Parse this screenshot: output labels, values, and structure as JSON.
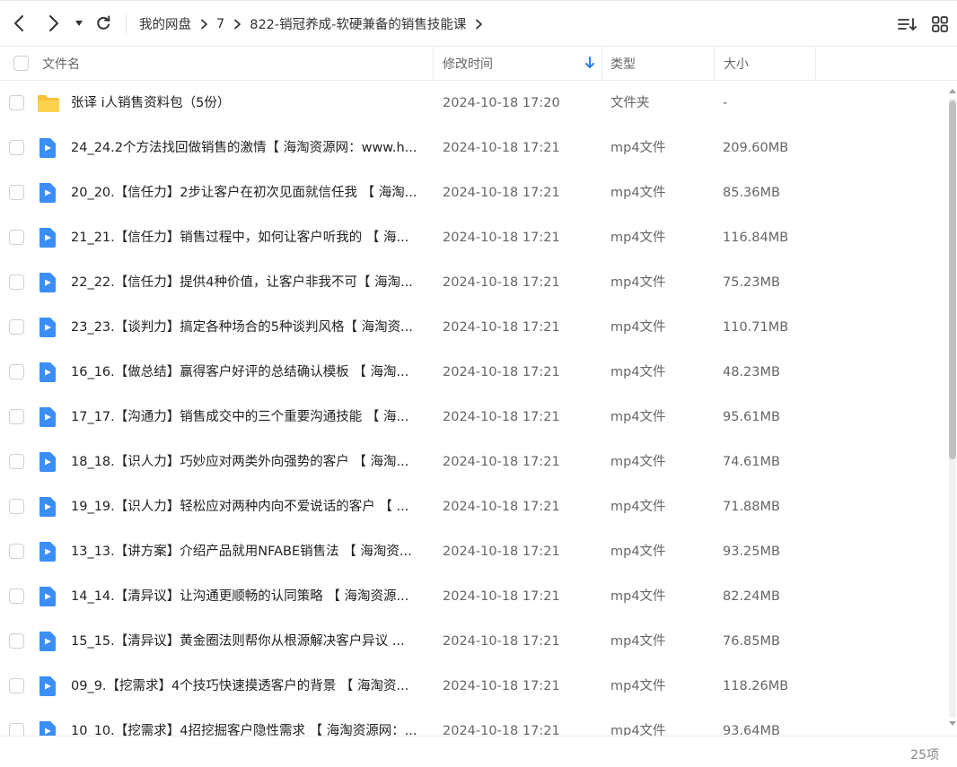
{
  "toolbar": {
    "breadcrumb": [
      "我的网盘",
      "7",
      "822-销冠养成-软硬兼备的销售技能课"
    ]
  },
  "columns": {
    "name": "文件名",
    "modified": "修改时间",
    "type": "类型",
    "size": "大小"
  },
  "files": [
    {
      "name": "张译 i人销售资料包（5份）",
      "modified": "2024-10-18 17:20",
      "type": "文件夹",
      "size": "-",
      "icon": "folder-icon"
    },
    {
      "name": "24_24.2个方法找回做销售的激情【 海淘资源网：www.h...",
      "modified": "2024-10-18 17:21",
      "type": "mp4文件",
      "size": "209.60MB",
      "icon": "video-file-icon"
    },
    {
      "name": "20_20.【信任力】2步让客户在初次见面就信任我 【 海淘...",
      "modified": "2024-10-18 17:21",
      "type": "mp4文件",
      "size": "85.36MB",
      "icon": "video-file-icon"
    },
    {
      "name": "21_21.【信任力】销售过程中，如何让客户听我的 【 海...",
      "modified": "2024-10-18 17:21",
      "type": "mp4文件",
      "size": "116.84MB",
      "icon": "video-file-icon"
    },
    {
      "name": "22_22.【信任力】提供4种价值，让客户非我不可【 海淘...",
      "modified": "2024-10-18 17:21",
      "type": "mp4文件",
      "size": "75.23MB",
      "icon": "video-file-icon"
    },
    {
      "name": "23_23.【谈判力】搞定各种场合的5种谈判风格【 海淘资...",
      "modified": "2024-10-18 17:21",
      "type": "mp4文件",
      "size": "110.71MB",
      "icon": "video-file-icon"
    },
    {
      "name": "16_16.【做总结】赢得客户好评的总结确认模板 【 海淘...",
      "modified": "2024-10-18 17:21",
      "type": "mp4文件",
      "size": "48.23MB",
      "icon": "video-file-icon"
    },
    {
      "name": "17_17.【沟通力】销售成交中的三个重要沟通技能 【 海...",
      "modified": "2024-10-18 17:21",
      "type": "mp4文件",
      "size": "95.61MB",
      "icon": "video-file-icon"
    },
    {
      "name": "18_18.【识人力】巧妙应对两类外向强势的客户 【 海淘...",
      "modified": "2024-10-18 17:21",
      "type": "mp4文件",
      "size": "74.61MB",
      "icon": "video-file-icon"
    },
    {
      "name": "19_19.【识人力】轻松应对两种内向不爱说话的客户 【 ...",
      "modified": "2024-10-18 17:21",
      "type": "mp4文件",
      "size": "71.88MB",
      "icon": "video-file-icon"
    },
    {
      "name": "13_13.【讲方案】介绍产品就用NFABE销售法 【 海淘资...",
      "modified": "2024-10-18 17:21",
      "type": "mp4文件",
      "size": "93.25MB",
      "icon": "video-file-icon"
    },
    {
      "name": "14_14.【清异议】让沟通更顺畅的认同策略 【 海淘资源...",
      "modified": "2024-10-18 17:21",
      "type": "mp4文件",
      "size": "82.24MB",
      "icon": "video-file-icon"
    },
    {
      "name": "15_15.【清异议】黄金圈法则帮你从根源解决客户异议 ...",
      "modified": "2024-10-18 17:21",
      "type": "mp4文件",
      "size": "76.85MB",
      "icon": "video-file-icon"
    },
    {
      "name": "09_9.【挖需求】4个技巧快速摸透客户的背景 【 海淘资...",
      "modified": "2024-10-18 17:21",
      "type": "mp4文件",
      "size": "118.26MB",
      "icon": "video-file-icon"
    },
    {
      "name": "10_10.【挖需求】4招挖掘客户隐性需求 【 海淘资源网：...",
      "modified": "2024-10-18 17:21",
      "type": "mp4文件",
      "size": "93.64MB",
      "icon": "video-file-icon"
    }
  ],
  "footer": {
    "count": "25项"
  },
  "colors": {
    "folder": "#f7c33b",
    "video": "#3a8ef6",
    "sort_arrow": "#2b7df0"
  }
}
